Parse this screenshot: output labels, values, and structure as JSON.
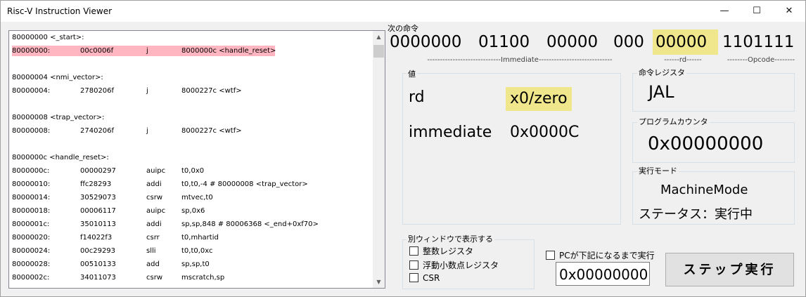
{
  "window": {
    "title": "Risc-V Instruction Viewer",
    "controls": {
      "minimize": "—",
      "maximize": "☐",
      "close": "✕"
    }
  },
  "listing": {
    "rows": [
      {
        "type": "label",
        "text": "80000000 <_start>:"
      },
      {
        "type": "instr",
        "addr": "80000000:",
        "hex": "00c0006f",
        "mn": "j",
        "op": "8000000c <handle_reset>",
        "highlight": true
      },
      {
        "type": "blank"
      },
      {
        "type": "label",
        "text": "80000004 <nmi_vector>:"
      },
      {
        "type": "instr",
        "addr": "80000004:",
        "hex": "2780206f",
        "mn": "j",
        "op": "8000227c <wtf>"
      },
      {
        "type": "blank"
      },
      {
        "type": "label",
        "text": "80000008 <trap_vector>:"
      },
      {
        "type": "instr",
        "addr": "80000008:",
        "hex": "2740206f",
        "mn": "j",
        "op": "8000227c <wtf>"
      },
      {
        "type": "blank"
      },
      {
        "type": "label",
        "text": "8000000c <handle_reset>:"
      },
      {
        "type": "instr",
        "addr": "8000000c:",
        "hex": "00000297",
        "mn": "auipc",
        "op": "t0,0x0"
      },
      {
        "type": "instr",
        "addr": "80000010:",
        "hex": "ffc28293",
        "mn": "addi",
        "op": "t0,t0,-4 # 80000008 <trap_vector>"
      },
      {
        "type": "instr",
        "addr": "80000014:",
        "hex": "30529073",
        "mn": "csrw",
        "op": "mtvec,t0"
      },
      {
        "type": "instr",
        "addr": "80000018:",
        "hex": "00006117",
        "mn": "auipc",
        "op": "sp,0x6"
      },
      {
        "type": "instr",
        "addr": "8000001c:",
        "hex": "35010113",
        "mn": "addi",
        "op": "sp,sp,848 # 80006368 <_end+0xf70>"
      },
      {
        "type": "instr",
        "addr": "80000020:",
        "hex": "f14022f3",
        "mn": "csrr",
        "op": "t0,mhartid"
      },
      {
        "type": "instr",
        "addr": "80000024:",
        "hex": "00c29293",
        "mn": "slli",
        "op": "t0,t0,0xc"
      },
      {
        "type": "instr",
        "addr": "80000028:",
        "hex": "00510133",
        "mn": "add",
        "op": "sp,sp,t0"
      },
      {
        "type": "instr",
        "addr": "8000002c:",
        "hex": "34011073",
        "mn": "csrw",
        "op": "mscratch,sp"
      }
    ]
  },
  "next_instruction": {
    "label": "次の命令",
    "bits": [
      "0000000",
      "01100",
      "00000",
      "000",
      "00000",
      "1101111"
    ],
    "fields": {
      "immediate": "-----------------------------Immediate-----------------------------",
      "rd": "------rd------",
      "opcode": "--------Opcode--------"
    }
  },
  "values_panel": {
    "label": "値",
    "rd_key": "rd",
    "rd_value": "x0/zero",
    "imm_key": "immediate",
    "imm_value": "0x0000C"
  },
  "instruction_register": {
    "label": "命令レジスタ",
    "value": "JAL"
  },
  "program_counter": {
    "label": "プログラムカウンタ",
    "value": "0x00000000"
  },
  "exec_mode": {
    "label": "実行モード",
    "mode": "MachineMode",
    "status": "ステータス：実行中"
  },
  "separate_window": {
    "label": "別ウィンドウで表示する",
    "options": [
      "整数レジスタ",
      "浮動小数点レジスタ",
      "CSR"
    ]
  },
  "run_until": {
    "label": "PCが下記になるまで実行",
    "value": "0x00000000"
  },
  "step_button": {
    "label": "ステップ実行"
  },
  "colors": {
    "highlight_row": "#ffb6c1",
    "field_highlight": "#f0e68c"
  }
}
